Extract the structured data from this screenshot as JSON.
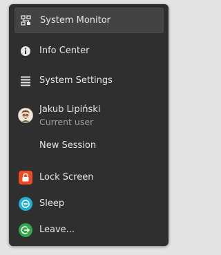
{
  "menu": {
    "items": [
      {
        "label": "System Monitor",
        "icon": "system-monitor-icon"
      },
      {
        "label": "Info Center",
        "icon": "info-icon"
      },
      {
        "label": "System Settings",
        "icon": "settings-list-icon"
      }
    ],
    "user": {
      "name": "Jakub Lipiński",
      "subtitle": "Current user",
      "icon": "avatar"
    },
    "new_session": "New Session",
    "actions": [
      {
        "label": "Lock Screen",
        "icon": "lock-icon",
        "color": "#f04a24"
      },
      {
        "label": "Sleep",
        "icon": "sleep-icon",
        "color": "#1fb1d8"
      },
      {
        "label": "Leave...",
        "icon": "leave-icon",
        "color": "#31a84a"
      }
    ]
  },
  "colors": {
    "menu_background": "#2f2f2f",
    "highlight": "#434343",
    "text": "#e6e6e6",
    "subtext": "#9a9a9a"
  }
}
